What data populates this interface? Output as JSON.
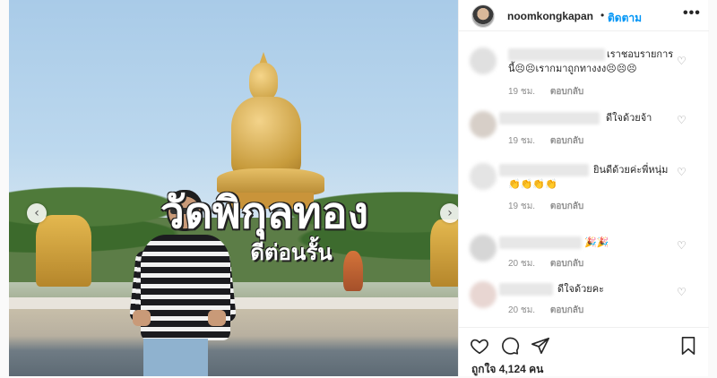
{
  "post": {
    "overlay_title": "วัดพิกุลทอง",
    "overlay_subtitle": "ดีต่อนรั้น"
  },
  "header": {
    "username": "noomkongkapan",
    "separator": "•",
    "follow_label": "ติดตาม",
    "more_icon": "•••"
  },
  "comments": [
    {
      "text_line1": "เราชอบรายการ",
      "text_line2": "นี้😣😣เรากมาถูกทางงง😣😣😣",
      "time": "19 ชม.",
      "reply": "ตอบกลับ"
    },
    {
      "text_line1": "ดีใจด้วยจ้า",
      "time": "19 ชม.",
      "reply": "ตอบกลับ"
    },
    {
      "text_line1": "👏👏👏👏",
      "text_suffix": "ยินดีด้วยค่ะพี่หนุ่ม",
      "time": "19 ชม.",
      "reply": "ตอบกลับ"
    },
    {
      "text_line1": "🎉🎉",
      "time": "20 ชม.",
      "reply": "ตอบกลับ"
    },
    {
      "text_line1": "ดีใจด้วยคะ",
      "time": "20 ชม.",
      "reply": "ตอบกลับ"
    }
  ],
  "actions": {
    "likes_text": "ถูกใจ 4,124 คน"
  },
  "icons": [
    "chevron-left-icon",
    "chevron-right-icon",
    "heart-icon",
    "comment-icon",
    "share-icon",
    "bookmark-icon"
  ],
  "colors": {
    "link": "#0095f6",
    "muted": "#8e8e8e",
    "text": "#262626"
  }
}
